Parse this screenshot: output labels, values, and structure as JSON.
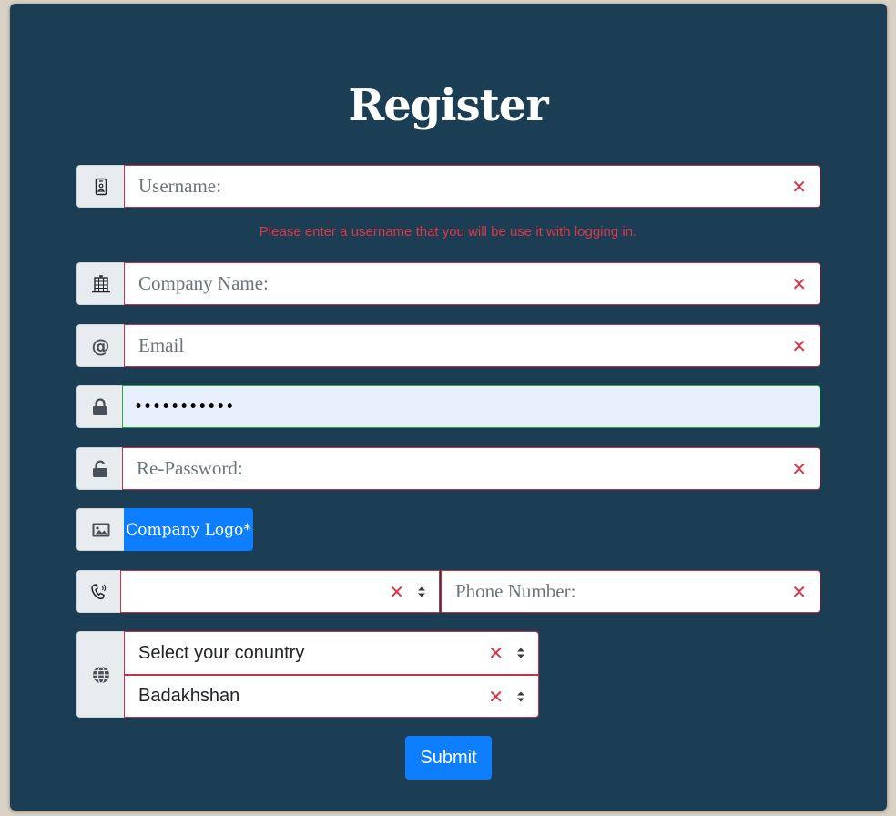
{
  "form": {
    "title": "Register",
    "username": {
      "placeholder": "Username:",
      "feedback": "Please enter a username that you will be use it with logging in."
    },
    "company_name": {
      "placeholder": "Company Name:"
    },
    "email": {
      "placeholder": "Email"
    },
    "password": {
      "value": "•••••••••••"
    },
    "re_password": {
      "placeholder": "Re-Password:"
    },
    "company_logo": {
      "label": "Company Logo*"
    },
    "phone": {
      "code_value": "",
      "placeholder": "Phone Number:"
    },
    "country": {
      "selected": "Select your conuntry"
    },
    "region": {
      "selected": "Badakhshan"
    },
    "submit_label": "Submit",
    "clear_symbol": "✕"
  },
  "icons": {
    "username": "id-badge-icon",
    "company": "building-icon",
    "email": "at-sign-icon",
    "password": "lock-icon",
    "re_password": "unlock-icon",
    "logo": "image-icon",
    "phone": "phone-vibrate-icon",
    "country": "globe-icon"
  },
  "colors": {
    "background": "#1b3e55",
    "invalid_border": "#c3314b",
    "valid_border": "#28a745",
    "error_text": "#dc3545",
    "primary": "#0d7eff",
    "autofill": "#e8f0fe"
  }
}
